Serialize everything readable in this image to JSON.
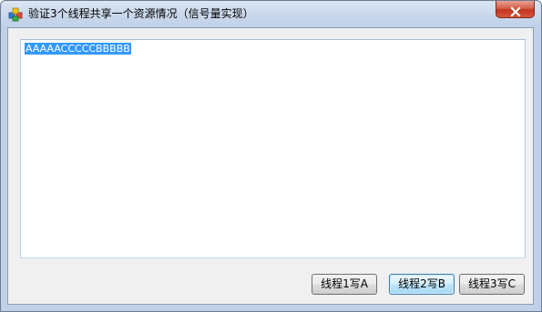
{
  "window": {
    "title": "验证3个线程共享一个资源情况（信号量实现）",
    "icons": {
      "app": "app-window-icon",
      "close": "close-icon"
    }
  },
  "textarea": {
    "value": "AAAAACCCCCBBBBB",
    "selected": true
  },
  "buttons": {
    "thread1": "线程1写A",
    "thread2": "线程2写B",
    "thread3": "线程3写C"
  },
  "colors": {
    "selection": "#3399ff",
    "close_button": "#c2371f",
    "default_button_border": "#3c7fb1"
  }
}
